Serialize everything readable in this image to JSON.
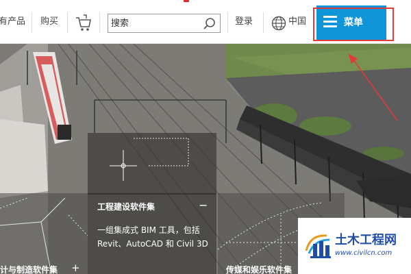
{
  "nav": {
    "all_products": "有产品",
    "buy": "购买",
    "search_placeholder": "搜索",
    "login": "登录",
    "region": "中国",
    "menu_label": "菜单"
  },
  "hero": {
    "center_panel": {
      "title": "工程建设软件集",
      "collapse_symbol": "−",
      "description": "一组集成式 BIM 工具，包括 Revit、AutoCAD 和 Civil 3D"
    },
    "left_panel": {
      "title": "计与制造软件集",
      "expand_symbol": "+"
    },
    "right_panel": {
      "title": "传媒和娱乐软件集"
    }
  },
  "watermark": {
    "title": "土木工程网",
    "url": "www.civilcn.com"
  },
  "colors": {
    "menu_accent": "#1195d9",
    "highlight_box": "#e23a3a",
    "watermark_blue": "#1f4da8"
  },
  "icons": [
    "cart-icon",
    "search-icon",
    "globe-icon",
    "hamburger-icon"
  ]
}
